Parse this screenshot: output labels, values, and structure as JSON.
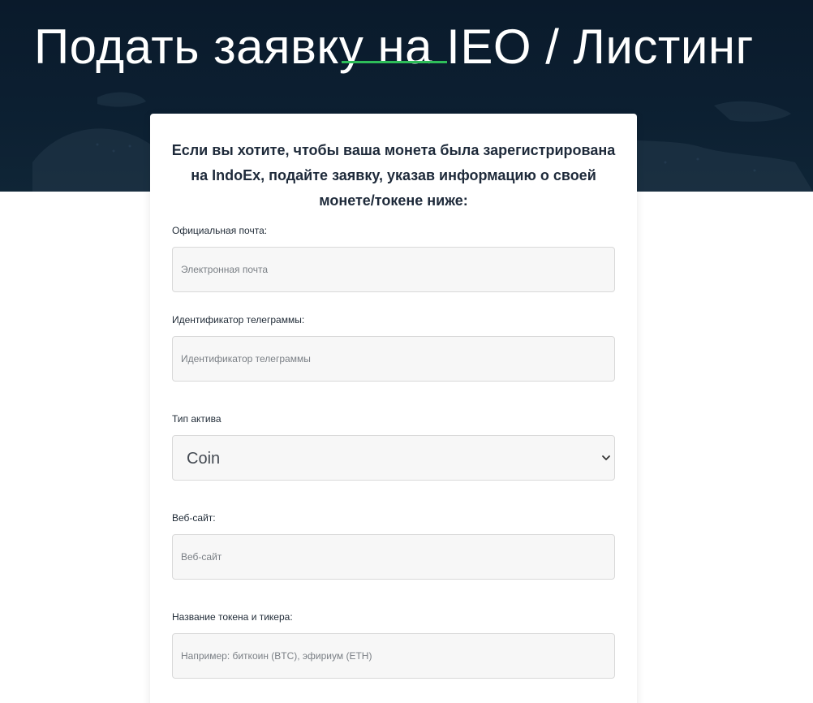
{
  "hero": {
    "title": "Подать заявку на IEO / Листинг",
    "accent_color": "#2ebd59",
    "background_color": "#0c1f31"
  },
  "form": {
    "intro": "Если вы хотите, чтобы ваша монета была зарегистрирована на IndoEx, подайте заявку, указав информацию о своей монете/токене ниже:",
    "fields": {
      "email": {
        "label": "Официальная почта:",
        "placeholder": "Электронная почта",
        "value": ""
      },
      "telegram": {
        "label": "Идентификатор телеграммы:",
        "placeholder": "Идентификатор телеграммы",
        "value": ""
      },
      "asset_type": {
        "label": "Тип актива",
        "selected": "Coin",
        "icon": "chevron-down-icon"
      },
      "website": {
        "label": "Веб-сайт:",
        "placeholder": "Веб-сайт",
        "value": ""
      },
      "token_name": {
        "label": "Название токена и тикера:",
        "placeholder": "Например: биткоин (BTC), эфириум (ETH)",
        "value": ""
      }
    }
  }
}
